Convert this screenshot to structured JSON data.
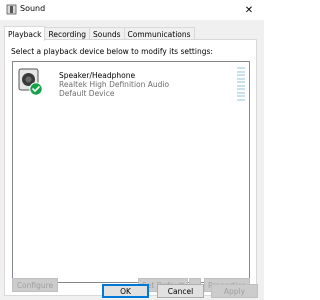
{
  "window": {
    "title": "Sound",
    "close_glyph": "✕"
  },
  "tabs": [
    {
      "label": "Playback",
      "active": true
    },
    {
      "label": "Recording",
      "active": false
    },
    {
      "label": "Sounds",
      "active": false
    },
    {
      "label": "Communications",
      "active": false
    }
  ],
  "playback": {
    "instruction": "Select a playback device below to modify its settings:",
    "device": {
      "name": "Speaker/Headphone",
      "driver": "Realtek High Definition Audio",
      "status": "Default Device",
      "icon": "speaker-icon",
      "badge_icon": "default-check-icon"
    }
  },
  "buttons": {
    "configure": "Configure",
    "set_default": "Set Default",
    "set_default_dropdown": "▾",
    "properties": "Properties",
    "ok": "OK",
    "cancel": "Cancel",
    "apply": "Apply"
  },
  "colors": {
    "accent": "#0078d7",
    "check": "#16a34a"
  }
}
